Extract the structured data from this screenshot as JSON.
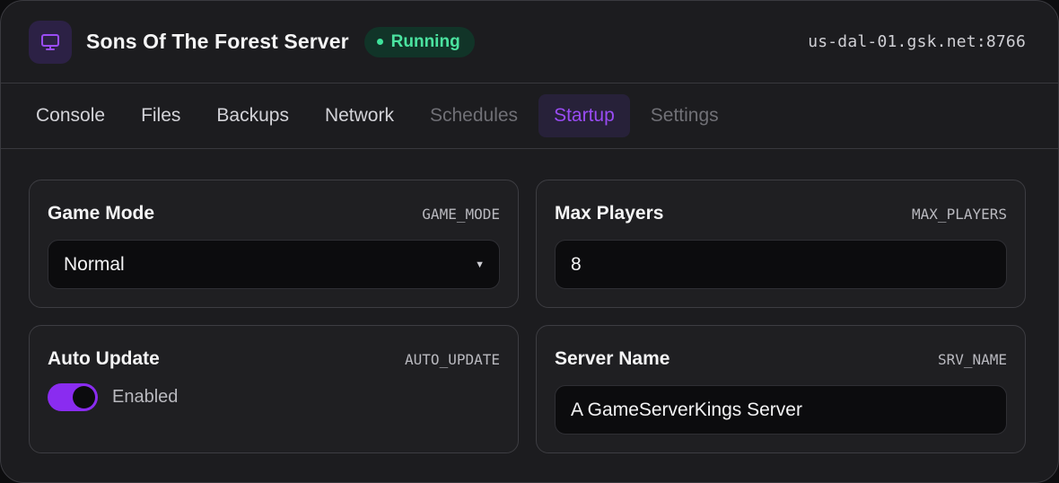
{
  "header": {
    "icon": "monitor-icon",
    "title": "Sons Of The Forest Server",
    "status": "Running",
    "address": "us-dal-01.gsk.net:8766"
  },
  "tabs": [
    {
      "label": "Console",
      "state": "normal"
    },
    {
      "label": "Files",
      "state": "normal"
    },
    {
      "label": "Backups",
      "state": "normal"
    },
    {
      "label": "Network",
      "state": "normal"
    },
    {
      "label": "Schedules",
      "state": "muted"
    },
    {
      "label": "Startup",
      "state": "active"
    },
    {
      "label": "Settings",
      "state": "muted"
    }
  ],
  "startup": {
    "game_mode": {
      "title": "Game Mode",
      "variable": "GAME_MODE",
      "value": "Normal"
    },
    "max_players": {
      "title": "Max Players",
      "variable": "MAX_PLAYERS",
      "value": "8"
    },
    "auto_update": {
      "title": "Auto Update",
      "variable": "AUTO_UPDATE",
      "enabled": true,
      "label": "Enabled"
    },
    "server_name": {
      "title": "Server Name",
      "variable": "SRV_NAME",
      "value": "A GameServerKings Server"
    }
  },
  "colors": {
    "accent": "#8a2cf0",
    "status_green": "#4be3a0",
    "background": "#1c1c1f"
  }
}
